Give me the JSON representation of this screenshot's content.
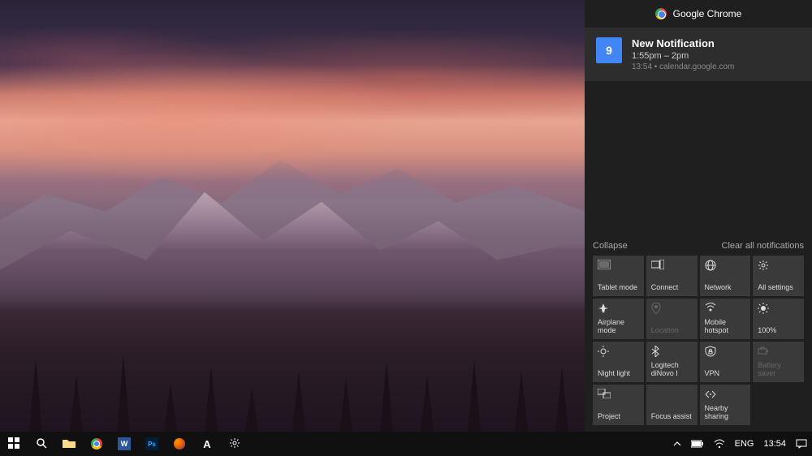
{
  "action_center": {
    "app_name": "Google Chrome",
    "notification": {
      "title": "New Notification",
      "time_range": "1:55pm – 2pm",
      "timestamp": "13:54",
      "source": "calendar.google.com",
      "calendar_day": "9"
    },
    "collapse_label": "Collapse",
    "clear_label": "Clear all notifications",
    "quick_actions": [
      {
        "label": "Tablet mode",
        "icon": "tablet",
        "disabled": false
      },
      {
        "label": "Connect",
        "icon": "connect",
        "disabled": false
      },
      {
        "label": "Network",
        "icon": "network",
        "disabled": false
      },
      {
        "label": "All settings",
        "icon": "settings",
        "disabled": false
      },
      {
        "label": "Airplane mode",
        "icon": "airplane",
        "disabled": false
      },
      {
        "label": "Location",
        "icon": "location",
        "disabled": true
      },
      {
        "label": "Mobile hotspot",
        "icon": "hotspot",
        "disabled": false
      },
      {
        "label": "100%",
        "icon": "brightness",
        "disabled": false
      },
      {
        "label": "Night light",
        "icon": "nightlight",
        "disabled": false
      },
      {
        "label": "Logitech diNovo I",
        "icon": "bluetooth",
        "disabled": false
      },
      {
        "label": "VPN",
        "icon": "vpn",
        "disabled": false
      },
      {
        "label": "Battery saver",
        "icon": "battery",
        "disabled": true
      },
      {
        "label": "Project",
        "icon": "project",
        "disabled": false
      },
      {
        "label": "Focus assist",
        "icon": "focus",
        "disabled": false
      },
      {
        "label": "Nearby sharing",
        "icon": "nearby",
        "disabled": false
      }
    ]
  },
  "taskbar": {
    "left_items": [
      {
        "name": "start",
        "icon": "windows"
      },
      {
        "name": "search",
        "icon": "search"
      },
      {
        "name": "file-explorer",
        "icon": "folder"
      },
      {
        "name": "chrome",
        "icon": "chrome"
      },
      {
        "name": "word",
        "icon": "word"
      },
      {
        "name": "photoshop",
        "icon": "ps"
      },
      {
        "name": "firefox",
        "icon": "firefox"
      },
      {
        "name": "app-a",
        "icon": "letter-a"
      },
      {
        "name": "settings",
        "icon": "gear"
      }
    ],
    "tray": {
      "chevron": "^",
      "battery": "battery",
      "wifi": "wifi",
      "lang": "ENG",
      "clock": "13:54",
      "notifications": "notif"
    }
  }
}
